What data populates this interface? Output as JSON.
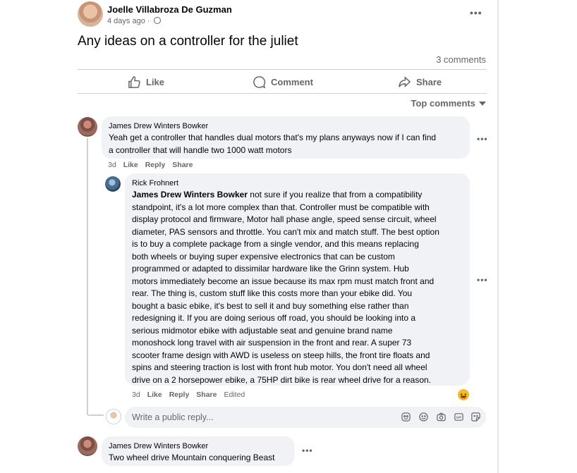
{
  "post": {
    "author": "Joelle Villabroza De Guzman",
    "time": "4 days ago ·",
    "text": "Any ideas on a controller for the juliet",
    "comment_count": "3 comments",
    "more": "•••"
  },
  "actions": {
    "like": "Like",
    "comment": "Comment",
    "share": "Share"
  },
  "sort": {
    "label": "Top comments"
  },
  "comments": [
    {
      "author": "James Drew Winters Bowker",
      "text_line1": "Yeah get a controller that handles dual motors that's my plans anyways now if I can find",
      "text_line2": "a controller that will handle two 1000 watt motors",
      "time": "3d",
      "like": "Like",
      "reply": "Reply",
      "share": "Share",
      "more": "•••"
    },
    {
      "author": "James Drew Winters Bowker",
      "text": "Two wheel drive Mountain conquering Beast",
      "more": "•••"
    }
  ],
  "reply": {
    "author": "Rick Frohnert",
    "mention": "James Drew Winters Bowker",
    "lines": [
      " not sure if you realize that from a compatibility",
      "standpoint, it's a lot more complex than that. Controller must be compatible with",
      "display protocol and firmware, Motor hall phase angle, speed sense circuit, wheel",
      "diameter, PAS sensors and throttle. You can't mix and match stuff. The best option",
      "is to buy a complete package from a single vendor, and this means replacing",
      "both wheels or buying super expensive electronics that can be custom",
      "programmed or adapted to dissimilar hardware like the Grinn system. Hub",
      "motors immediately become an issue because its max rpm must match front and",
      "rear. The thing is, custom stuff like this costs more than your ebike did. You",
      "bought a basic ebike, it's best to sell it and buy something else rather than",
      "redesigning it. If you are doing serious off road, you should be looking into a",
      "serious midmotor ebike with adjustable seat and genuine brand name",
      "monoshock long travel with air suspension in the front and rear. A super 73",
      "scooter frame design with AWD is useless on steep hills, the front tire floats and",
      "spins and steering traction is lost with front hub motor. You don't need all wheel",
      "drive on a 2 horsepower ebike, a 75HP dirt bike is rear wheel drive for a reason."
    ],
    "time": "3d",
    "like": "Like",
    "reply": "Reply",
    "share": "Share",
    "edited": "Edited",
    "more": "•••"
  },
  "reply_box": {
    "placeholder": "Write a public reply..."
  }
}
